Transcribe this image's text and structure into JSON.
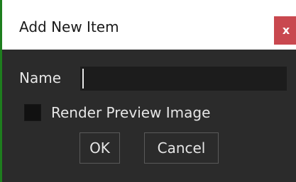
{
  "dialog": {
    "title": "Add New Item",
    "close_label": "x"
  },
  "form": {
    "name_label": "Name",
    "name_value": "",
    "render_preview_label": "Render Preview Image",
    "render_preview_checked": false
  },
  "buttons": {
    "ok_label": "OK",
    "cancel_label": "Cancel"
  },
  "colors": {
    "body_background": "#2b2b2b",
    "close_button": "#c9484f",
    "left_accent": "#1e7e1e"
  }
}
